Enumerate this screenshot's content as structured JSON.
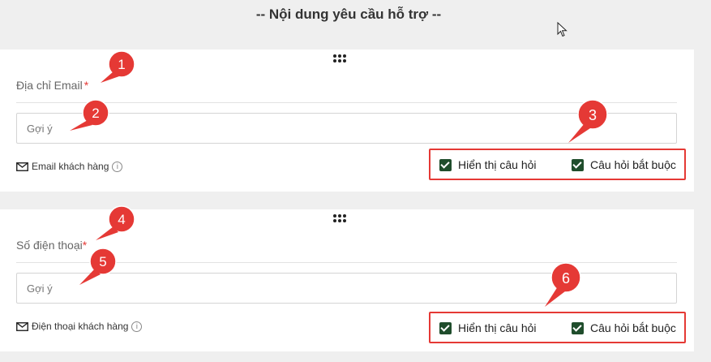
{
  "page": {
    "section_title": "-- Nội dung yêu cầu hỗ trợ --"
  },
  "questions": [
    {
      "label": "Địa chỉ Email",
      "required_mark": "*",
      "placeholder": "Gợi ý",
      "field_type": "Email khách hàng",
      "info_glyph": "i",
      "show_question_label": "Hiển thị câu hỏi",
      "required_question_label": "Câu hỏi bắt buộc",
      "show_question_checked": true,
      "required_question_checked": true
    },
    {
      "label": "Số điện thoại",
      "required_mark": "*",
      "placeholder": "Gợi ý",
      "field_type": "Điện thoại khách hàng",
      "info_glyph": "i",
      "show_question_label": "Hiển thị câu hỏi",
      "required_question_label": "Câu hỏi bắt buộc",
      "show_question_checked": true,
      "required_question_checked": true
    }
  ],
  "annotations": [
    "1",
    "2",
    "3",
    "4",
    "5",
    "6"
  ],
  "colors": {
    "annotation_red": "#e53935",
    "checkbox_green": "#1f4d2c",
    "background": "#efefef"
  },
  "icons": {
    "drag_handle": "drag-handle-icon",
    "field_type": "envelope-icon",
    "cursor": "mouse-pointer-icon"
  }
}
